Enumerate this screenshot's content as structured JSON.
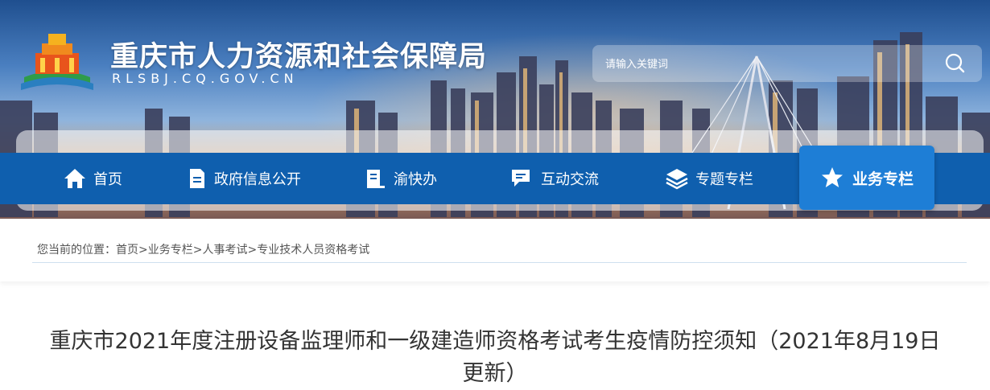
{
  "site": {
    "title": "重庆市人力资源和社会保障局",
    "domain": "RLSBJ.CQ.GOV.CN"
  },
  "search": {
    "placeholder": "请输入关键词",
    "icon": "search-icon"
  },
  "nav": {
    "items": [
      {
        "label": "首页",
        "icon": "home-icon"
      },
      {
        "label": "政府信息公开",
        "icon": "document-icon"
      },
      {
        "label": "渝快办",
        "icon": "book-icon"
      },
      {
        "label": "互动交流",
        "icon": "chat-icon"
      },
      {
        "label": "专题专栏",
        "icon": "layers-icon"
      },
      {
        "label": "业务专栏",
        "icon": "star-icon",
        "active": true
      }
    ]
  },
  "breadcrumb": {
    "prefix": "您当前的位置：",
    "items": [
      "首页",
      "业务专栏",
      "人事考试",
      "专业技术人员资格考试"
    ],
    "separator": ">"
  },
  "article": {
    "title": "重庆市2021年度注册设备监理师和一级建造师资格考试考生疫情防控须知（2021年8月19日更新）"
  },
  "colors": {
    "nav_bg": "#0f5fae",
    "nav_active": "#1e7ed6",
    "text": "#333333"
  }
}
